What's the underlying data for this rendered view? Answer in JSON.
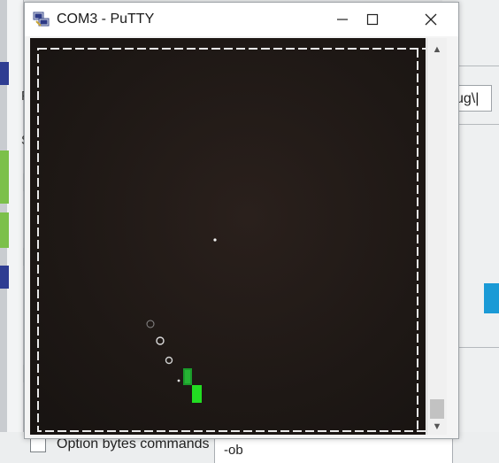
{
  "window": {
    "title": "COM3 - PuTTY",
    "minimize_glyph": "—",
    "maximize_glyph": "☐",
    "close_glyph": "✕"
  },
  "background_app": {
    "right_field_text": "ug\\|",
    "left_chars": [
      "F",
      "S"
    ],
    "option_label": "Option bytes commands",
    "option_value": "-ob"
  },
  "scrollbar": {
    "up_glyph": "▲",
    "down_glyph": "▼"
  },
  "icons": {
    "app": "putty-icon",
    "minimize": "minimize-icon",
    "maximize": "maximize-icon",
    "close": "close-icon"
  },
  "colors": {
    "terminal_bg": "#1e1815",
    "border_dash": "#e8e8e8",
    "snake_green": "#22dd22",
    "food_white": "#f2f2f2",
    "accent_blue": "#1a9ad6"
  }
}
